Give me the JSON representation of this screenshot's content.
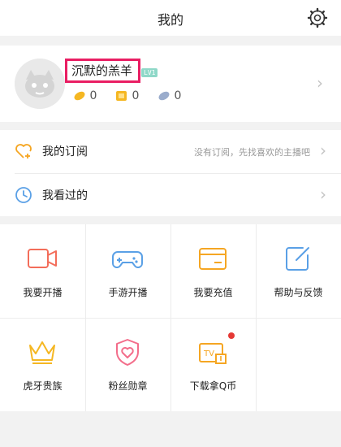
{
  "header": {
    "title": "我的"
  },
  "profile": {
    "username": "沉默的羔羊",
    "level": "LV1",
    "stats": [
      {
        "icon": "bean-icon",
        "value": "0"
      },
      {
        "icon": "coupon-icon",
        "value": "0"
      },
      {
        "icon": "silver-bean-icon",
        "value": "0"
      }
    ]
  },
  "list": [
    {
      "label": "我的订阅",
      "hint": "没有订阅，先找喜欢的主播吧",
      "icon": "heart-plus-icon"
    },
    {
      "label": "我看过的",
      "hint": "",
      "icon": "clock-icon"
    }
  ],
  "grid": [
    {
      "label": "我要开播",
      "icon": "video-camera-icon"
    },
    {
      "label": "手游开播",
      "icon": "gamepad-icon"
    },
    {
      "label": "我要充值",
      "icon": "wallet-icon"
    },
    {
      "label": "帮助与反馈",
      "icon": "edit-icon"
    },
    {
      "label": "虎牙贵族",
      "icon": "crown-icon"
    },
    {
      "label": "粉丝勋章",
      "icon": "heart-shield-icon"
    },
    {
      "label": "下载拿Q币",
      "icon": "tv-download-icon",
      "badge": true
    }
  ],
  "colors": {
    "highlight": "#e91e63",
    "accent": "#f5a623",
    "blue": "#5aa0e6",
    "red": "#f36d5a"
  }
}
